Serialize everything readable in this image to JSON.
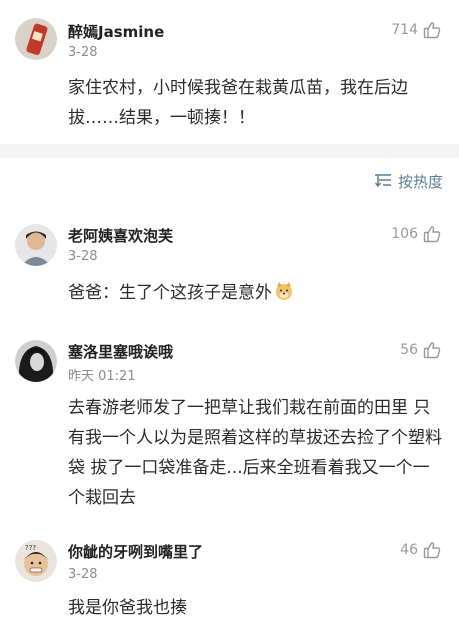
{
  "comments": [
    {
      "name": "醉嫣Jasmine",
      "date": "3-28",
      "likes": "714",
      "text": "家住农村，小时候我爸在栽黄瓜苗，我在后边拔……结果，一顿揍！！"
    },
    {
      "name": "老阿姨喜欢泡芙",
      "date": "3-28",
      "likes": "106",
      "text": "爸爸：生了个这孩子是意外",
      "emoji": "doge-emoji"
    },
    {
      "name": "塞洛里塞哦诶哦",
      "date": "昨天 01:21",
      "likes": "56",
      "text": "去春游老师发了一把草让我们栽在前面的田里 只有我一个人以为是照着这样的草拔还去捡了个塑料袋 拔了一口袋准备走...后来全班看着我又一个一个栽回去"
    },
    {
      "name": "你龇的牙咧到嘴里了",
      "date": "3-28",
      "likes": "46",
      "text": "我是你爸我也揍"
    }
  ],
  "sort": {
    "label": "按热度",
    "icon": "sort-icon"
  },
  "colors": {
    "link": "#5a7f99",
    "meta": "#8c8c8c",
    "divider": "#f3f3f3"
  }
}
